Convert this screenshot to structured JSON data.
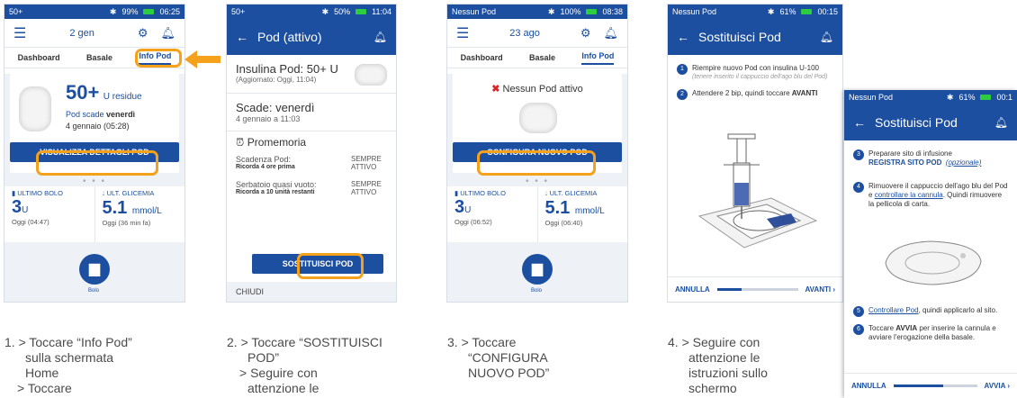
{
  "screen1": {
    "status": {
      "left": "50+",
      "battery": "99%",
      "time": "06:25"
    },
    "topbar": {
      "date": "2 gen"
    },
    "tabs": [
      "Dashboard",
      "Basale",
      "Info Pod"
    ],
    "insulin_value": "50+",
    "insulin_unit": "U residue",
    "expiry_label": "Pod scade",
    "expiry_day": "venerdì",
    "expiry_date": "4 gennaio (05:28)",
    "details_button": "VISUALIZZA DETTAGLI POD",
    "last_bolus_label": "ULTIMO BOLO",
    "last_bolus_value": "3",
    "last_bolus_unit": "U",
    "last_bolus_time": "Oggi (04:47)",
    "glucose_label": "ULT. GLICEMIA",
    "glucose_value": "5.1",
    "glucose_unit": "mmol/L",
    "glucose_time": "Oggi (36 min fa)",
    "bolus_label": "Bolo"
  },
  "screen2": {
    "status": {
      "left": "50+",
      "battery": "50%",
      "time": "11:04"
    },
    "title": "Pod (attivo)",
    "insulin_line": "Insulina Pod: 50+ U",
    "updated": "(Aggiornato: Oggi, 11:04)",
    "expires": "Scade: venerdì",
    "expires_date": "4 gennaio a 11:03",
    "reminders_title": "Promemoria",
    "reminder1_label": "Scadenza Pod:",
    "reminder1_sub": "Ricorda 4 ore prima",
    "reminder1_state": "SEMPRE ATTIVO",
    "reminder2_label": "Serbatoio quasi vuoto:",
    "reminder2_sub": "Ricorda a 10 unità restanti",
    "reminder2_state": "SEMPRE ATTIVO",
    "replace_button": "SOSTITUISCI POD",
    "close": "CHIUDI"
  },
  "screen3": {
    "status": {
      "left": "Nessun Pod",
      "battery": "100%",
      "time": "08:38"
    },
    "topbar": {
      "date": "23 ago"
    },
    "tabs": [
      "Dashboard",
      "Basale",
      "Info Pod"
    ],
    "no_pod": "Nessun Pod attivo",
    "configure_button": "CONFIGURA NUOVO POD",
    "last_bolus_label": "ULTIMO BOLO",
    "last_bolus_value": "3",
    "last_bolus_unit": "U",
    "last_bolus_time": "Oggi (06:52)",
    "glucose_label": "ULT. GLICEMIA",
    "glucose_value": "5.1",
    "glucose_unit": "mmol/L",
    "glucose_time": "Oggi (06:40)",
    "bolus_label": "Bolo"
  },
  "screen4": {
    "status": {
      "left": "Nessun Pod",
      "battery": "61%",
      "time": "00:15"
    },
    "title": "Sostituisci Pod",
    "step1": "Riempire nuovo Pod con insulina U-100",
    "step1_note": "(tenere inserito il cappuccio dell'ago blu del Pod)",
    "step2_pre": "Attendere 2 bip, quindi toccare",
    "step2_bold": "AVANTI",
    "cancel": "ANNULLA",
    "next": "AVANTI",
    "progress": 0.3
  },
  "screen5": {
    "status": {
      "left": "Nessun Pod",
      "battery": "61%",
      "time": "00:1"
    },
    "title": "Sostituisci Pod",
    "step3": "Preparare sito di infusione",
    "step3_link": "REGISTRA SITO POD",
    "step3_opt": "(opzionale)",
    "step4_a": "Rimuovere il cappuccio dell'ago blu del Pod e",
    "step4_link": "controllare la cannula",
    "step4_b": ". Quindi rimuovere la pellicola di carta.",
    "step5_link": "Controllare Pod",
    "step5_b": ", quindi applicarlo al sito.",
    "step6_a": "Toccare",
    "step6_bold": "AVVIA",
    "step6_b": "per inserire la cannula e avviare l'erogazione della basale.",
    "cancel": "ANNULLA",
    "next": "AVVIA",
    "progress": 0.6
  },
  "captions": {
    "c1": [
      "1. > Toccare “Info Pod”",
      "sulla schermata",
      "Home",
      "> Toccare"
    ],
    "c2": [
      "2. > Toccare “SOSTITUISCI",
      "POD”",
      "> Seguire con",
      "attenzione le"
    ],
    "c3": [
      "3. > Toccare",
      "“CONFIGURA",
      "NUOVO POD”"
    ],
    "c4": [
      "4. > Seguire con",
      "attenzione le",
      "istruzioni sullo",
      "schermo"
    ]
  },
  "colors": {
    "brand": "#1c4fa0",
    "highlight": "#f5a11b",
    "error": "#d9262b"
  }
}
